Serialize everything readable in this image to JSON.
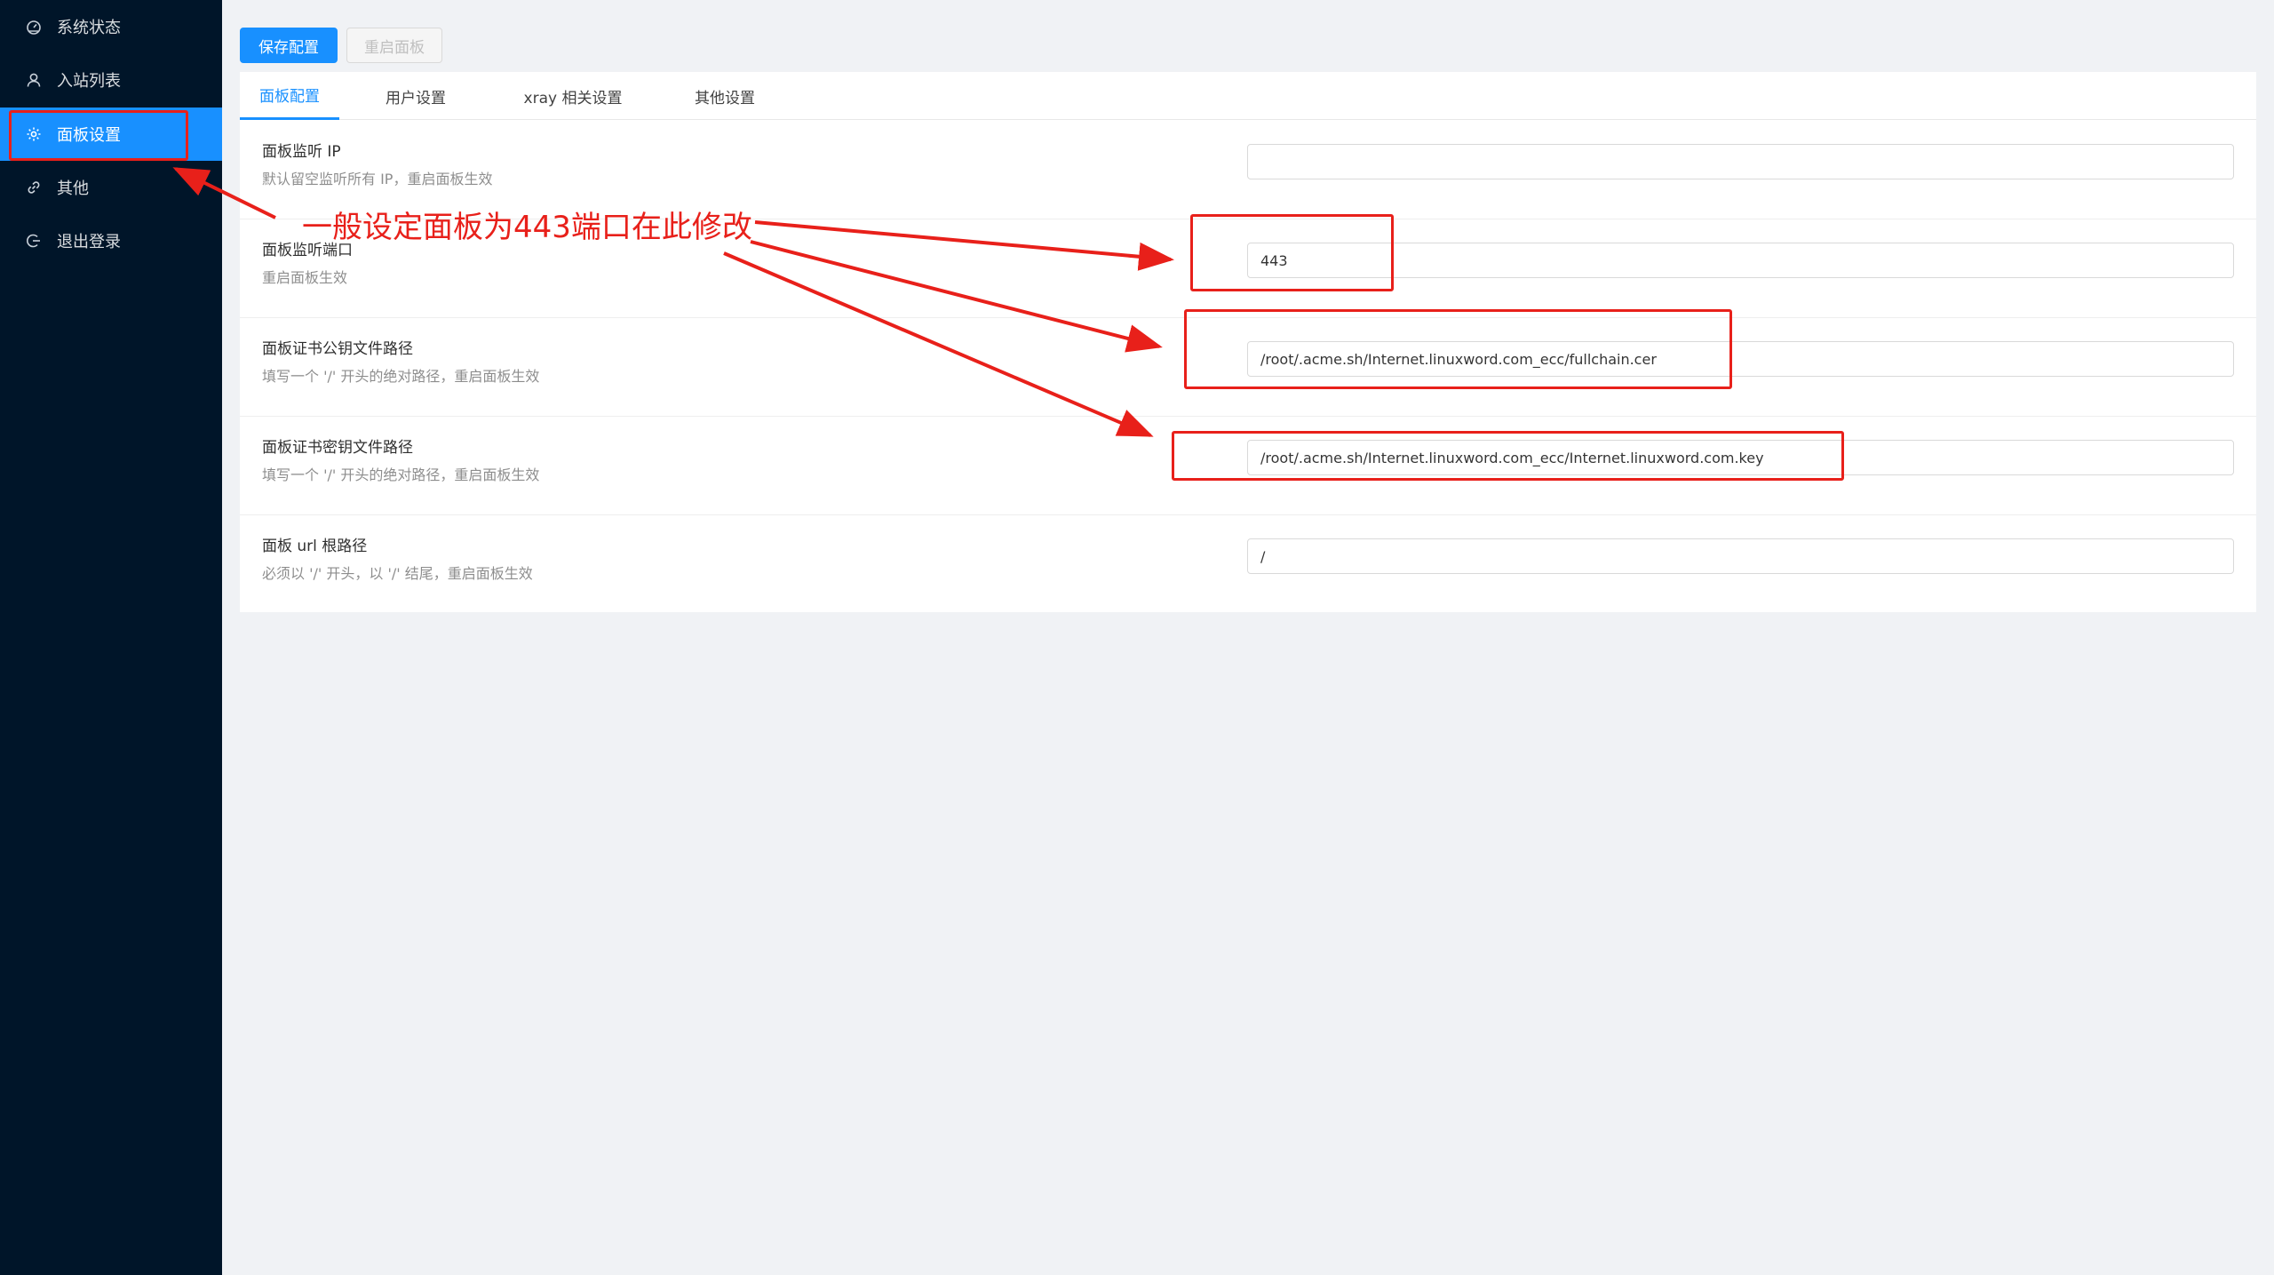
{
  "sidebar": {
    "items": [
      {
        "label": "系统状态",
        "icon": "dashboard-icon"
      },
      {
        "label": "入站列表",
        "icon": "user-icon"
      },
      {
        "label": "面板设置",
        "icon": "gear-icon",
        "active": true
      },
      {
        "label": "其他",
        "icon": "link-icon",
        "has_submenu": true
      },
      {
        "label": "退出登录",
        "icon": "logout-icon"
      }
    ]
  },
  "toolbar": {
    "save_label": "保存配置",
    "restart_label": "重启面板"
  },
  "tabs": [
    {
      "label": "面板配置",
      "active": true
    },
    {
      "label": "用户设置"
    },
    {
      "label": "xray 相关设置"
    },
    {
      "label": "其他设置"
    }
  ],
  "settings": [
    {
      "label": "面板监听 IP",
      "desc": "默认留空监听所有 IP，重启面板生效",
      "value": ""
    },
    {
      "label": "面板监听端口",
      "desc": "重启面板生效",
      "value": "443"
    },
    {
      "label": "面板证书公钥文件路径",
      "desc": "填写一个 '/' 开头的绝对路径，重启面板生效",
      "value": "/root/.acme.sh/Internet.linuxword.com_ecc/fullchain.cer"
    },
    {
      "label": "面板证书密钥文件路径",
      "desc": "填写一个 '/' 开头的绝对路径，重启面板生效",
      "value": "/root/.acme.sh/Internet.linuxword.com_ecc/Internet.linuxword.com.key"
    },
    {
      "label": "面板 url 根路径",
      "desc": "必须以 '/' 开头，以 '/' 结尾，重启面板生效",
      "value": "/"
    }
  ],
  "annotation": {
    "text": "一般设定面板为443端口在此修改",
    "color": "#e8201a"
  },
  "colors": {
    "sidebar_bg": "#001529",
    "accent": "#1890ff",
    "page_bg": "#f0f2f5"
  }
}
